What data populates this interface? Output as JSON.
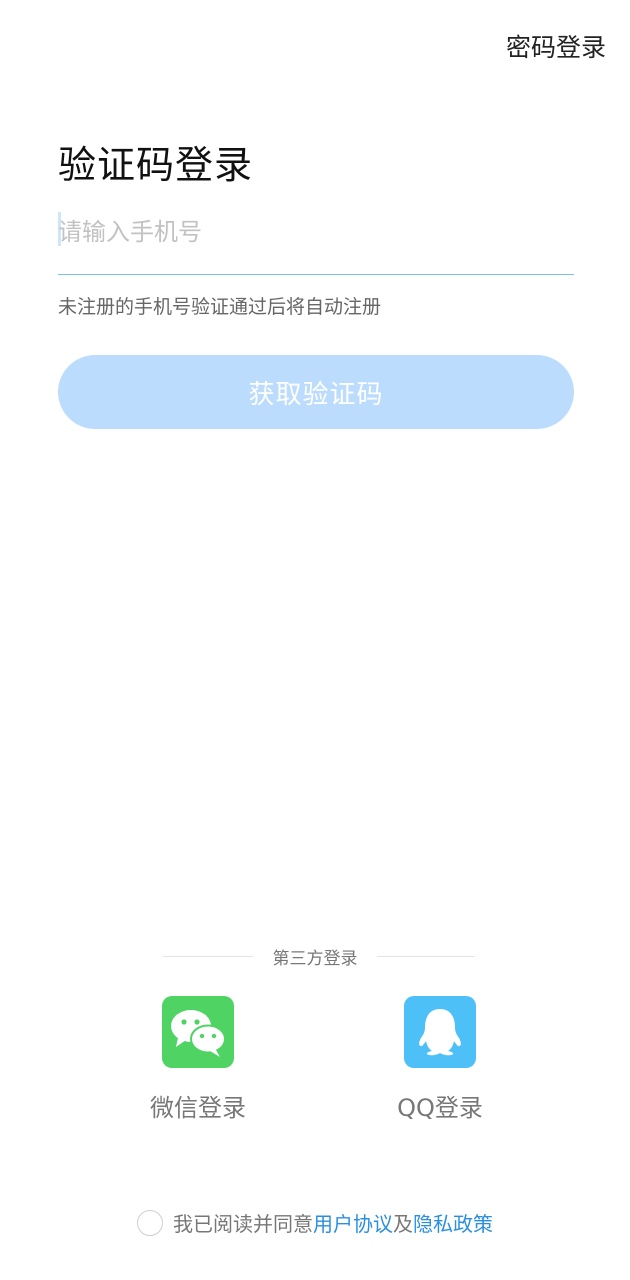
{
  "header": {
    "switch_label": "密码登录"
  },
  "title": "验证码登录",
  "phone": {
    "placeholder": "请输入手机号",
    "value": ""
  },
  "hint": "未注册的手机号验证通过后将自动注册",
  "get_code_label": "获取验证码",
  "third_party": {
    "label": "第三方登录",
    "wechat_label": "微信登录",
    "qq_label": "QQ登录"
  },
  "agreement": {
    "prefix": "我已阅读并同意",
    "user_agreement": "用户协议",
    "and": "及",
    "privacy_policy": "隐私政策"
  },
  "colors": {
    "accent": "#2b8fe0",
    "button_disabled": "#bcdcfd",
    "wechat": "#4fd363",
    "qq": "#4dc0f7"
  }
}
